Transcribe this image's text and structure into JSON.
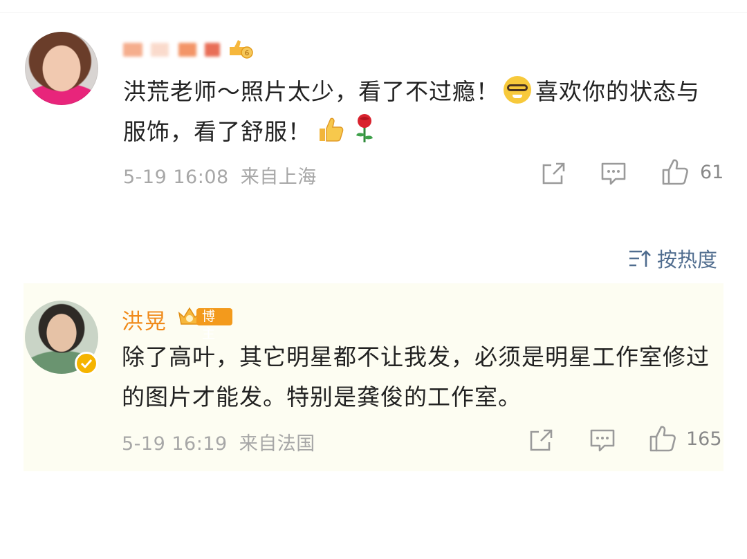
{
  "comments": [
    {
      "username_obscured": true,
      "text_part1": "洪荒老师～照片太少，看了不过瘾！",
      "emoji_1": "nerd-face-emoji",
      "text_part2": "喜欢你的状态与服饰，看了舒服！",
      "emoji_2": "thumbs-up-emoji",
      "emoji_3": "rose-emoji",
      "time": "5-19 16:08",
      "location": "来自上海",
      "likes": "61"
    },
    {
      "username": "洪晃",
      "badge": "博主",
      "text": "除了高叶，其它明星都不让我发，必须是明星工作室修过的图片才能发。特别是龚俊的工作室。",
      "time": "5-19 16:19",
      "location": "来自法国",
      "likes": "165"
    }
  ],
  "sort": {
    "label": "按热度",
    "icon": "sort-icon"
  },
  "icons": [
    "share-icon",
    "comment-icon",
    "like-icon",
    "verified-icon"
  ],
  "colors": {
    "username": "#f08a1a",
    "meta": "#a7a7a7",
    "sort": "#4f6c8e",
    "highlight_bg": "#fdfdf2",
    "badge": "#f39a1c",
    "verified": "#f5b400"
  }
}
